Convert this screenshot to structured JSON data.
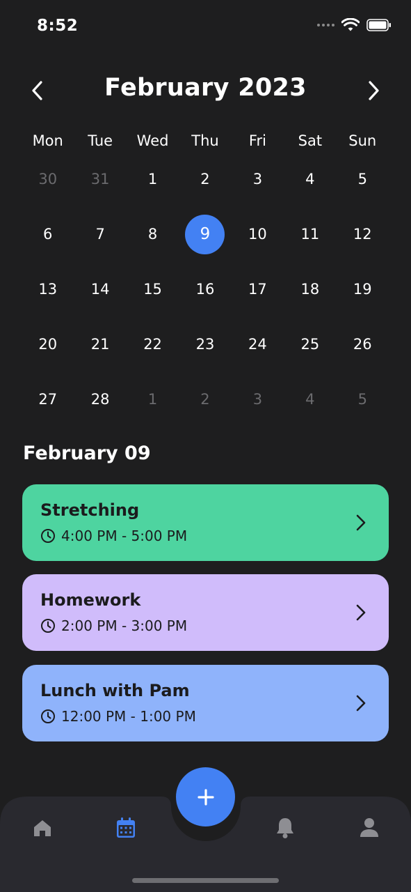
{
  "status_bar": {
    "time": "8:52"
  },
  "calendar": {
    "month_title": "February 2023",
    "weekdays": [
      "Mon",
      "Tue",
      "Wed",
      "Thu",
      "Fri",
      "Sat",
      "Sun"
    ],
    "days": [
      {
        "label": "30",
        "muted": true
      },
      {
        "label": "31",
        "muted": true
      },
      {
        "label": "1"
      },
      {
        "label": "2"
      },
      {
        "label": "3"
      },
      {
        "label": "4"
      },
      {
        "label": "5"
      },
      {
        "label": "6"
      },
      {
        "label": "7"
      },
      {
        "label": "8"
      },
      {
        "label": "9",
        "selected": true
      },
      {
        "label": "10"
      },
      {
        "label": "11"
      },
      {
        "label": "12"
      },
      {
        "label": "13"
      },
      {
        "label": "14"
      },
      {
        "label": "15"
      },
      {
        "label": "16"
      },
      {
        "label": "17"
      },
      {
        "label": "18"
      },
      {
        "label": "19"
      },
      {
        "label": "20"
      },
      {
        "label": "21"
      },
      {
        "label": "22"
      },
      {
        "label": "23"
      },
      {
        "label": "24"
      },
      {
        "label": "25"
      },
      {
        "label": "26"
      },
      {
        "label": "27"
      },
      {
        "label": "28"
      },
      {
        "label": "1",
        "muted": true
      },
      {
        "label": "2",
        "muted": true
      },
      {
        "label": "3",
        "muted": true
      },
      {
        "label": "4",
        "muted": true
      },
      {
        "label": "5",
        "muted": true
      }
    ],
    "selected_color": "#4381f3"
  },
  "events_section": {
    "title": "February 09",
    "events": [
      {
        "title": "Stretching",
        "time": "4:00 PM - 5:00 PM",
        "color": "#4ed4a0"
      },
      {
        "title": "Homework",
        "time": "2:00 PM - 3:00 PM",
        "color": "#d0bcfb"
      },
      {
        "title": "Lunch with Pam",
        "time": "12:00 PM - 1:00 PM",
        "color": "#8fb3fb"
      }
    ]
  },
  "tab_bar": {
    "tabs": [
      {
        "name": "home",
        "icon": "home-icon",
        "active": false
      },
      {
        "name": "calendar",
        "icon": "calendar-icon",
        "active": true
      },
      {
        "name": "notifications",
        "icon": "bell-icon",
        "active": false
      },
      {
        "name": "profile",
        "icon": "user-icon",
        "active": false
      }
    ],
    "fab_icon": "plus-icon",
    "active_color": "#4381f3",
    "inactive_color": "#8e8e93"
  }
}
